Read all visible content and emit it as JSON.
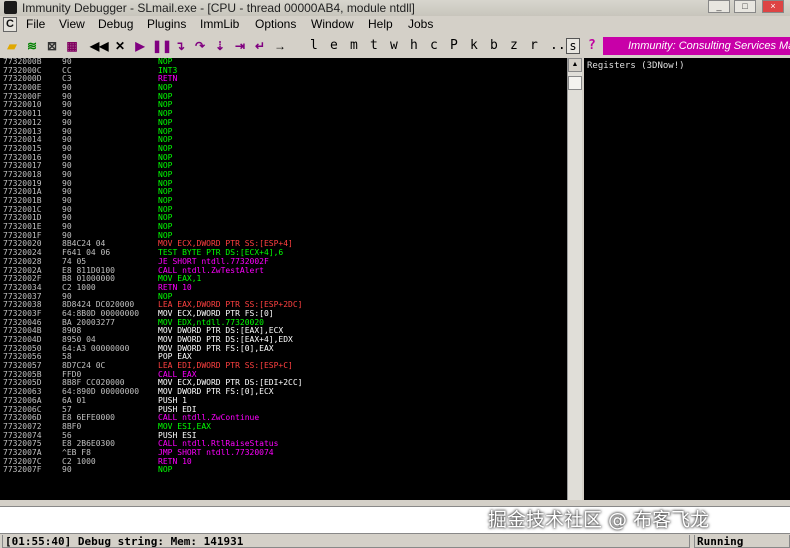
{
  "window": {
    "title": "Immunity Debugger - SLmail.exe - [CPU - thread 00000AB4, module ntdll]"
  },
  "menu": {
    "sys_icon": "C",
    "items": [
      "File",
      "View",
      "Debug",
      "Plugins",
      "ImmLib",
      "Options",
      "Window",
      "Help",
      "Jobs"
    ]
  },
  "toolbar": {
    "icons": [
      "open-icon",
      "restart-icon",
      "close-program-icon",
      "toolbar-icon-4",
      "rewind-icon",
      "stop-icon",
      "run-icon",
      "pause-icon",
      "step-into-icon",
      "step-over-icon",
      "trace-into-icon",
      "trace-over-icon",
      "execute-till-return-icon",
      "go-to-icon"
    ],
    "letters": [
      "l",
      "e",
      "m",
      "t",
      "w",
      "h",
      "c",
      "P",
      "k",
      "b",
      "z",
      "r",
      "...",
      "s",
      "?"
    ],
    "banner": "Immunity: Consulting Services Manager"
  },
  "colors": {
    "address": "#c0c0c0",
    "hex": "#c0c0c0",
    "nop": "#00ff00",
    "mov": "#00ff00",
    "call": "#ff00ff",
    "jump": "#ff00ff",
    "ptr": "#ff4040",
    "int3": "#00ff00",
    "ret": "#ff00ff",
    "push": "#ffffff"
  },
  "disassembly": [
    {
      "addr": "7732000B",
      "hex": "90",
      "instr": "NOP",
      "kind": "nop"
    },
    {
      "addr": "7732000C",
      "hex": "CC",
      "instr": "INT3",
      "kind": "int3"
    },
    {
      "addr": "7732000D",
      "hex": "C3",
      "instr": "RETN",
      "kind": "ret"
    },
    {
      "addr": "7732000E",
      "hex": "90",
      "instr": "NOP",
      "kind": "nop"
    },
    {
      "addr": "7732000F",
      "hex": "90",
      "instr": "NOP",
      "kind": "nop"
    },
    {
      "addr": "77320010",
      "hex": "90",
      "instr": "NOP",
      "kind": "nop"
    },
    {
      "addr": "77320011",
      "hex": "90",
      "instr": "NOP",
      "kind": "nop"
    },
    {
      "addr": "77320012",
      "hex": "90",
      "instr": "NOP",
      "kind": "nop"
    },
    {
      "addr": "77320013",
      "hex": "90",
      "instr": "NOP",
      "kind": "nop"
    },
    {
      "addr": "77320014",
      "hex": "90",
      "instr": "NOP",
      "kind": "nop"
    },
    {
      "addr": "77320015",
      "hex": "90",
      "instr": "NOP",
      "kind": "nop"
    },
    {
      "addr": "77320016",
      "hex": "90",
      "instr": "NOP",
      "kind": "nop"
    },
    {
      "addr": "77320017",
      "hex": "90",
      "instr": "NOP",
      "kind": "nop"
    },
    {
      "addr": "77320018",
      "hex": "90",
      "instr": "NOP",
      "kind": "nop"
    },
    {
      "addr": "77320019",
      "hex": "90",
      "instr": "NOP",
      "kind": "nop"
    },
    {
      "addr": "7732001A",
      "hex": "90",
      "instr": "NOP",
      "kind": "nop"
    },
    {
      "addr": "7732001B",
      "hex": "90",
      "instr": "NOP",
      "kind": "nop"
    },
    {
      "addr": "7732001C",
      "hex": "90",
      "instr": "NOP",
      "kind": "nop"
    },
    {
      "addr": "7732001D",
      "hex": "90",
      "instr": "NOP",
      "kind": "nop"
    },
    {
      "addr": "7732001E",
      "hex": "90",
      "instr": "NOP",
      "kind": "nop"
    },
    {
      "addr": "7732001F",
      "hex": "90",
      "instr": "NOP",
      "kind": "nop"
    },
    {
      "addr": "77320020",
      "hex": "8B4C24 04",
      "instr": "MOV ECX,DWORD PTR SS:[ESP+4]",
      "kind": "ptr"
    },
    {
      "addr": "77320024",
      "hex": "F641 04 06",
      "instr": "TEST BYTE PTR DS:[ECX+4],6",
      "kind": "mov"
    },
    {
      "addr": "77320028",
      "hex": "74 05",
      "instr": "JE SHORT ntdll.7732002F",
      "kind": "jump"
    },
    {
      "addr": "7732002A",
      "hex": "E8 811D0100",
      "instr": "CALL ntdll.ZwTestAlert",
      "kind": "call"
    },
    {
      "addr": "7732002F",
      "hex": "B8 01000000",
      "instr": "MOV EAX,1",
      "kind": "mov"
    },
    {
      "addr": "77320034",
      "hex": "C2 1000",
      "instr": "RETN 10",
      "kind": "ret"
    },
    {
      "addr": "77320037",
      "hex": "90",
      "instr": "NOP",
      "kind": "nop"
    },
    {
      "addr": "77320038",
      "hex": "8D8424 DC020000",
      "instr": "LEA EAX,DWORD PTR SS:[ESP+2DC]",
      "kind": "ptr"
    },
    {
      "addr": "7732003F",
      "hex": "64:8B0D 00000000",
      "instr": "MOV ECX,DWORD PTR FS:[0]",
      "kind": "push"
    },
    {
      "addr": "77320046",
      "hex": "BA 20003277",
      "instr": "MOV EDX,ntdll.77320020",
      "kind": "mov"
    },
    {
      "addr": "7732004B",
      "hex": "8908",
      "instr": "MOV DWORD PTR DS:[EAX],ECX",
      "kind": "push"
    },
    {
      "addr": "7732004D",
      "hex": "8950 04",
      "instr": "MOV DWORD PTR DS:[EAX+4],EDX",
      "kind": "push"
    },
    {
      "addr": "77320050",
      "hex": "64:A3 00000000",
      "instr": "MOV DWORD PTR FS:[0],EAX",
      "kind": "push"
    },
    {
      "addr": "77320056",
      "hex": "58",
      "instr": "POP EAX",
      "kind": "push"
    },
    {
      "addr": "77320057",
      "hex": "8D7C24 0C",
      "instr": "LEA EDI,DWORD PTR SS:[ESP+C]",
      "kind": "ptr"
    },
    {
      "addr": "7732005B",
      "hex": "FFD0",
      "instr": "CALL EAX",
      "kind": "call"
    },
    {
      "addr": "7732005D",
      "hex": "8B8F CC020000",
      "instr": "MOV ECX,DWORD PTR DS:[EDI+2CC]",
      "kind": "push"
    },
    {
      "addr": "77320063",
      "hex": "64:890D 00000000",
      "instr": "MOV DWORD PTR FS:[0],ECX",
      "kind": "push"
    },
    {
      "addr": "7732006A",
      "hex": "6A 01",
      "instr": "PUSH 1",
      "kind": "push"
    },
    {
      "addr": "7732006C",
      "hex": "57",
      "instr": "PUSH EDI",
      "kind": "push"
    },
    {
      "addr": "7732006D",
      "hex": "E8 6EFE0000",
      "instr": "CALL ntdll.ZwContinue",
      "kind": "call"
    },
    {
      "addr": "77320072",
      "hex": "8BF0",
      "instr": "MOV ESI,EAX",
      "kind": "mov"
    },
    {
      "addr": "77320074",
      "hex": "56",
      "instr": "PUSH ESI",
      "kind": "push"
    },
    {
      "addr": "77320075",
      "hex": "E8 2B6E0300",
      "instr": "CALL ntdll.RtlRaiseStatus",
      "kind": "call"
    },
    {
      "addr": "7732007A",
      "hex": "^EB F8",
      "instr": "JMP SHORT ntdll.77320074",
      "kind": "jump"
    },
    {
      "addr": "7732007C",
      "hex": "C2 1000",
      "instr": "RETN 10",
      "kind": "ret"
    },
    {
      "addr": "7732007F",
      "hex": "90",
      "instr": "NOP",
      "kind": "nop"
    }
  ],
  "registers": {
    "header": "Registers (3DNow!)"
  },
  "command": {
    "value": ""
  },
  "watermark": "掘金技术社区 @ 布客飞龙",
  "status": {
    "message": "[01:55:40] Debug string: Mem: 141931",
    "state": "Running"
  }
}
